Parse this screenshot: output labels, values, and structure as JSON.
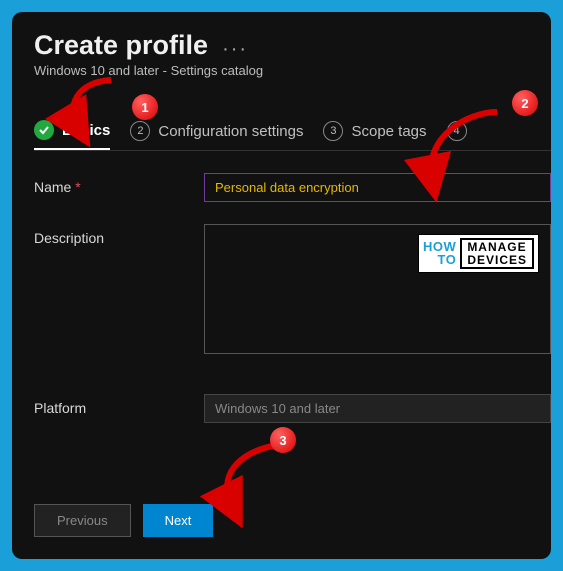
{
  "header": {
    "title": "Create profile",
    "subtitle": "Windows 10 and later - Settings catalog"
  },
  "tabs": {
    "t1": {
      "label": "Basics"
    },
    "t2": {
      "num": "2",
      "label": "Configuration settings"
    },
    "t3": {
      "num": "3",
      "label": "Scope tags"
    },
    "t4": {
      "num": "4"
    }
  },
  "form": {
    "name_label": "Name",
    "name_value": "Personal data encryption",
    "desc_label": "Description",
    "desc_value": "",
    "platform_label": "Platform",
    "platform_value": "Windows 10 and later"
  },
  "buttons": {
    "prev": "Previous",
    "next": "Next"
  },
  "callouts": {
    "c1": "1",
    "c2": "2",
    "c3": "3"
  },
  "logo": {
    "how": "HOW",
    "to": "TO",
    "manage": "MANAGE",
    "devices": "DEVICES"
  }
}
